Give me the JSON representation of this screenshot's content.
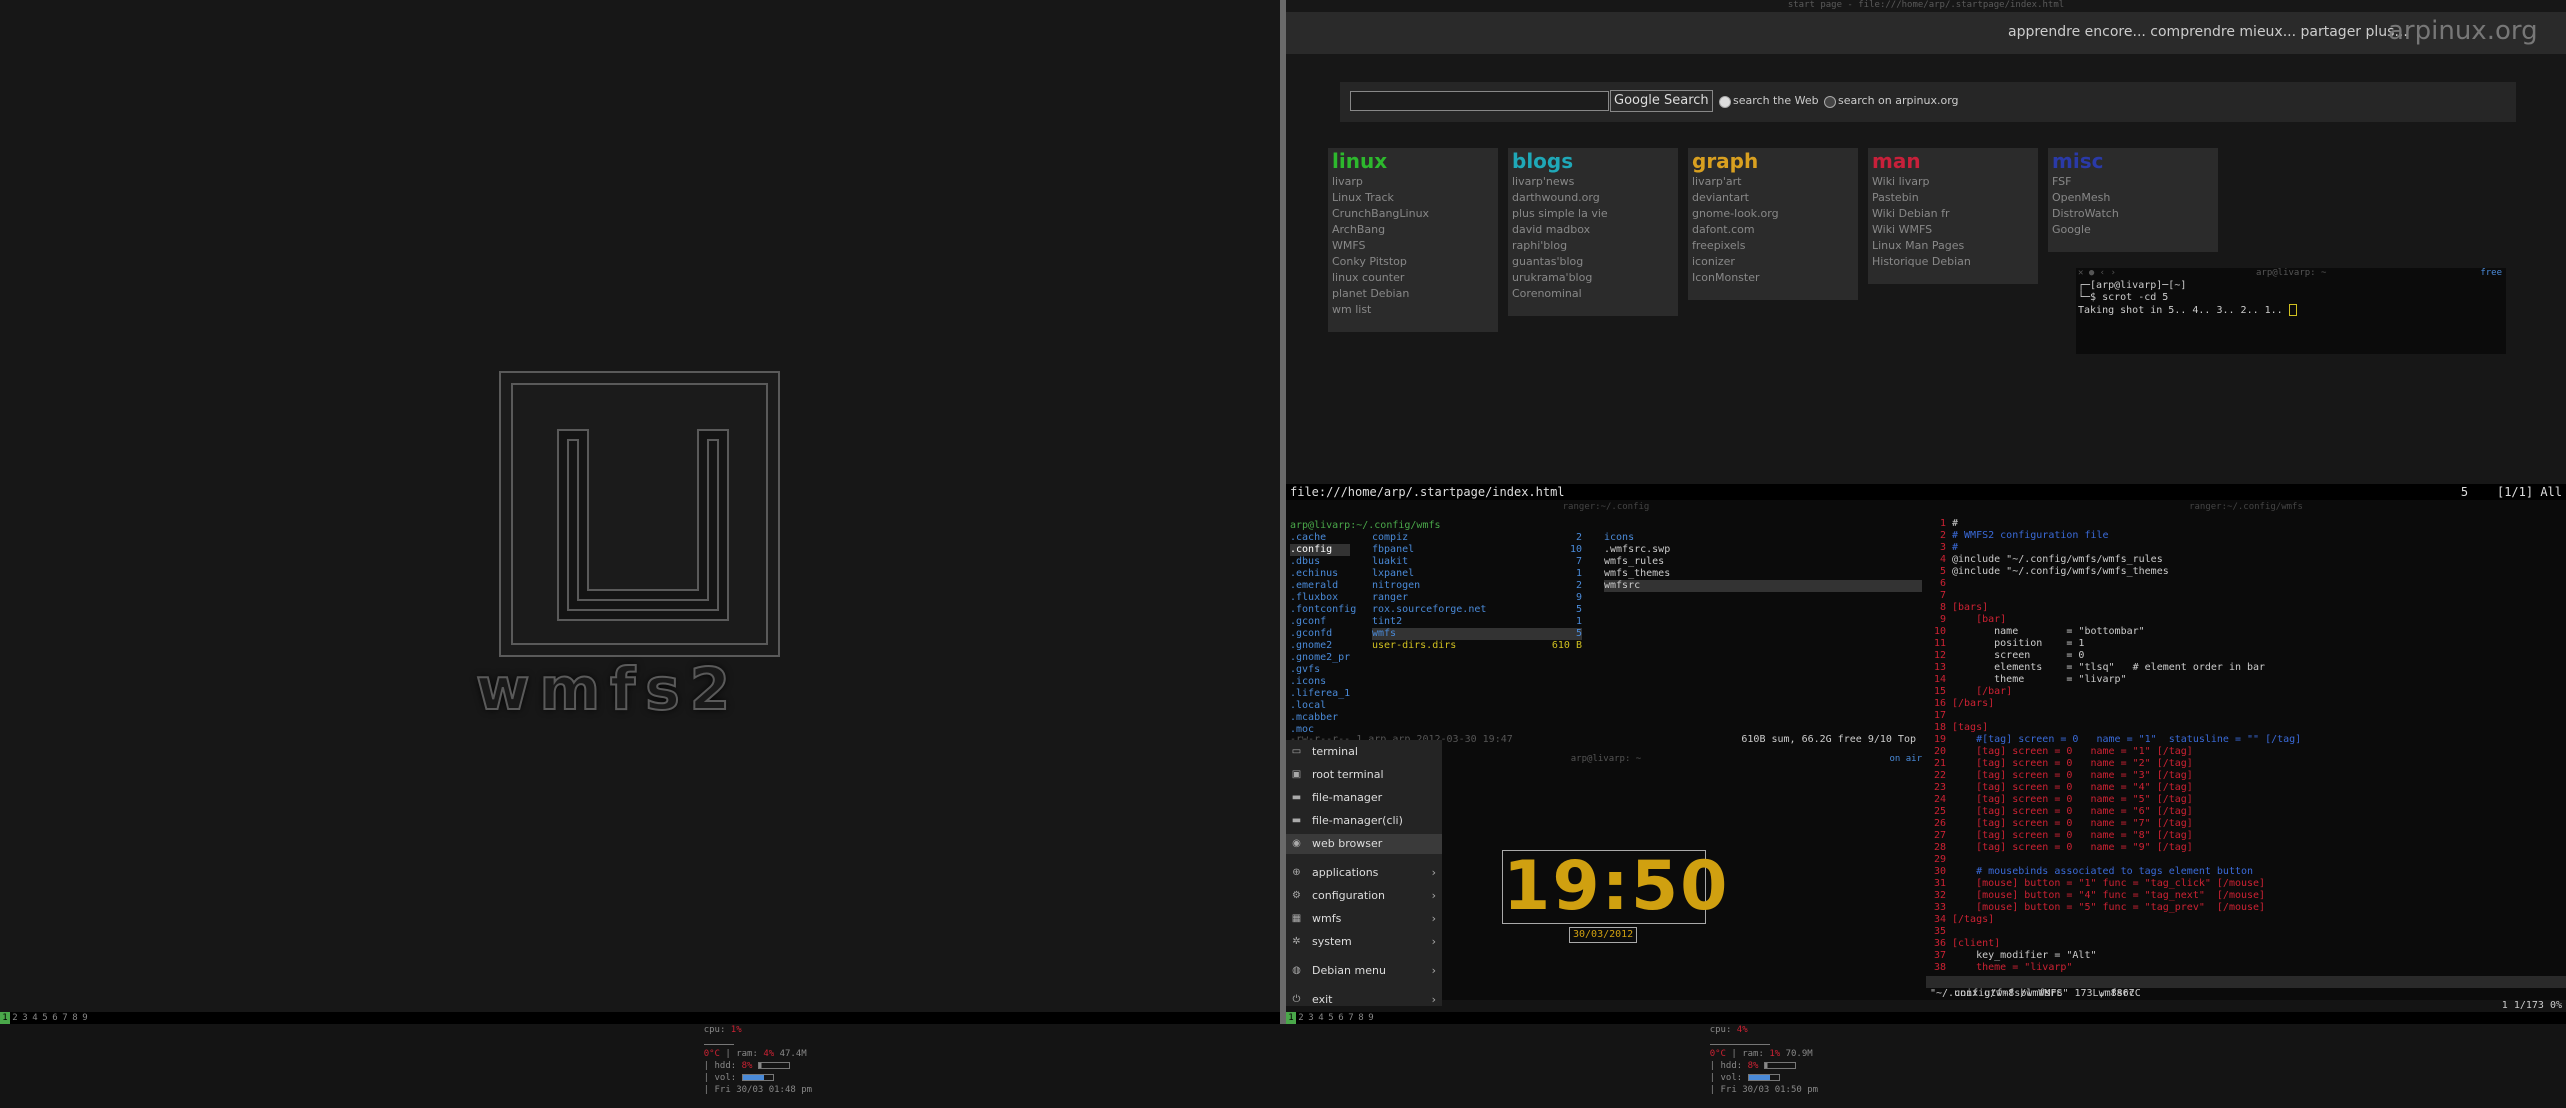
{
  "left_screen": {
    "logo_text": "wmfs2",
    "tags": [
      "1",
      "2",
      "3",
      "4",
      "5",
      "6",
      "7",
      "8",
      "9"
    ],
    "status": {
      "cpu_label": "cpu:",
      "cpu_value": "1%",
      "temp": "0°C",
      "ram_label": "ram:",
      "ram_pct": "4%",
      "ram_value": "47.4M",
      "hdd_label": "hdd:",
      "hdd_value": "8%",
      "vol_label": "vol:",
      "datetime": "Fri 30/03 01:48 pm",
      "cpu_fraction": 0.01,
      "ram_fraction": 0.04,
      "hdd_fraction": 0.08,
      "vol_fraction": 0.7
    }
  },
  "browser": {
    "window_title": "start page - file:///home/arp/.startpage/index.html",
    "tagline": "apprendre encore... comprendre mieux... partager plus...",
    "site_name": "arpinux.org",
    "search_button": "Google Search",
    "radio_web": "search the Web",
    "radio_site": "search on arpinux.org",
    "categories": [
      {
        "title": "linux",
        "color": "#2db82d",
        "links": [
          "livarp",
          "Linux Track",
          "CrunchBangLinux",
          "ArchBang",
          "WMFS",
          "Conky Pitstop",
          "linux counter",
          "planet Debian",
          "wm list"
        ]
      },
      {
        "title": "blogs",
        "color": "#1fa8b8",
        "links": [
          "livarp'news",
          "darthwound.org",
          "plus simple la vie",
          "david madbox",
          "raphi'blog",
          "guantas'blog",
          "urukrama'blog",
          "Corenominal"
        ]
      },
      {
        "title": "graph",
        "color": "#d9a020",
        "links": [
          "livarp'art",
          "deviantart",
          "gnome-look.org",
          "dafont.com",
          "freepixels",
          "iconizer",
          "IconMonster"
        ]
      },
      {
        "title": "man",
        "color": "#c8203a",
        "links": [
          "Wiki livarp",
          "Pastebin",
          "Wiki Debian fr",
          "Wiki WMFS",
          "Linux Man Pages",
          "Historique Debian"
        ]
      },
      {
        "title": "misc",
        "color": "#2a3aa8",
        "links": [
          "FSF",
          "OpenMesh",
          "DistroWatch",
          "Google"
        ]
      }
    ],
    "mini_terminal": {
      "title": "arp@livarp: ~",
      "free": "free",
      "lines": [
        "┌─[arp@livarp]─[~]",
        "└─$ scrot -cd 5",
        "Taking shot in 5.. 4.. 3.. 2.. 1.. "
      ]
    },
    "status_url": "file:///home/arp/.startpage/index.html",
    "status_right": "5    [1/1] All"
  },
  "ranger": {
    "title": "ranger:~/.config",
    "path": "arp@livarp:~/.config/wmfs",
    "col1": [
      ".cache",
      ".config",
      ".dbus",
      ".echinus",
      ".emerald",
      ".fluxbox",
      ".fontconfig",
      ".gconf",
      ".gconfd",
      ".gnome2",
      ".gnome2_pr",
      ".gvfs",
      ".icons",
      ".liferea_1",
      ".local",
      ".mcabber",
      ".moc"
    ],
    "col2": [
      {
        "name": "compiz",
        "n": "2"
      },
      {
        "name": "fbpanel",
        "n": "10"
      },
      {
        "name": "luakit",
        "n": "7"
      },
      {
        "name": "lxpanel",
        "n": "1"
      },
      {
        "name": "nitrogen",
        "n": "2"
      },
      {
        "name": "ranger",
        "n": "9"
      },
      {
        "name": "rox.sourceforge.net",
        "n": "5"
      },
      {
        "name": "tint2",
        "n": "1"
      },
      {
        "name": "wmfs",
        "n": "5"
      },
      {
        "name": "user-dirs.dirs",
        "n": "610 B"
      }
    ],
    "col3": [
      "icons",
      ".wmfsrc.swp",
      "wmfs_rules",
      "wmfs_themes",
      "wmfsrc"
    ],
    "status_left": "-rw-r--r-- 1 arp arp 2012-03-30 19:47",
    "status_right": "610B sum, 66.2G free  9/10  Top"
  },
  "vim": {
    "title": "ranger:~/.config/wmfs",
    "lines": [
      {
        "n": "1",
        "t": "#",
        "c": "#ccc"
      },
      {
        "n": "2",
        "t": "# WMFS2 configuration file",
        "c": "#3a6ad8"
      },
      {
        "n": "3",
        "t": "#",
        "c": "#3a6ad8"
      },
      {
        "n": "4",
        "t": "@include \"~/.config/wmfs/wmfs_rules",
        "c": "#ccc"
      },
      {
        "n": "5",
        "t": "@include \"~/.config/wmfs/wmfs_themes",
        "c": "#ccc"
      },
      {
        "n": "6",
        "t": "",
        "c": "#ccc"
      },
      {
        "n": "7",
        "t": "",
        "c": "#ccc"
      },
      {
        "n": "8",
        "t": "[bars]",
        "c": "#c23"
      },
      {
        "n": "9",
        "t": "    [bar]",
        "c": "#c23"
      },
      {
        "n": "10",
        "t": "       name        = \"bottombar\"",
        "c": "#ccc"
      },
      {
        "n": "11",
        "t": "       position    = 1",
        "c": "#ccc"
      },
      {
        "n": "12",
        "t": "       screen      = 0",
        "c": "#ccc"
      },
      {
        "n": "13",
        "t": "       elements    = \"tlsq\"   # element order in bar",
        "c": "#ccc"
      },
      {
        "n": "14",
        "t": "       theme       = \"livarp\"",
        "c": "#ccc"
      },
      {
        "n": "15",
        "t": "    [/bar]",
        "c": "#c23"
      },
      {
        "n": "16",
        "t": "[/bars]",
        "c": "#c23"
      },
      {
        "n": "17",
        "t": "",
        "c": "#ccc"
      },
      {
        "n": "18",
        "t": "[tags]",
        "c": "#c23"
      },
      {
        "n": "19",
        "t": "    #[tag] screen = 0   name = \"1\"  statusline = \"\" [/tag]",
        "c": "#3a6ad8"
      },
      {
        "n": "20",
        "t": "    [tag] screen = 0   name = \"1\" [/tag]",
        "c": "#c23"
      },
      {
        "n": "21",
        "t": "    [tag] screen = 0   name = \"2\" [/tag]",
        "c": "#c23"
      },
      {
        "n": "22",
        "t": "    [tag] screen = 0   name = \"3\" [/tag]",
        "c": "#c23"
      },
      {
        "n": "23",
        "t": "    [tag] screen = 0   name = \"4\" [/tag]",
        "c": "#c23"
      },
      {
        "n": "24",
        "t": "    [tag] screen = 0   name = \"5\" [/tag]",
        "c": "#c23"
      },
      {
        "n": "25",
        "t": "    [tag] screen = 0   name = \"6\" [/tag]",
        "c": "#c23"
      },
      {
        "n": "26",
        "t": "    [tag] screen = 0   name = \"7\" [/tag]",
        "c": "#c23"
      },
      {
        "n": "27",
        "t": "    [tag] screen = 0   name = \"8\" [/tag]",
        "c": "#c23"
      },
      {
        "n": "28",
        "t": "    [tag] screen = 0   name = \"9\" [/tag]",
        "c": "#c23"
      },
      {
        "n": "29",
        "t": "",
        "c": "#ccc"
      },
      {
        "n": "30",
        "t": "    # mousebinds associated to tags element button",
        "c": "#3a6ad8"
      },
      {
        "n": "31",
        "t": "    [mouse] button = \"1\" func = \"tag_click\" [/mouse]",
        "c": "#c23"
      },
      {
        "n": "32",
        "t": "    [mouse] button = \"4\" func = \"tag_next\"  [/mouse]",
        "c": "#c23"
      },
      {
        "n": "33",
        "t": "    [mouse] button = \"5\" func = \"tag_prev\"  [/mouse]",
        "c": "#c23"
      },
      {
        "n": "34",
        "t": "[/tags]",
        "c": "#c23"
      },
      {
        "n": "35",
        "t": "",
        "c": "#ccc"
      },
      {
        "n": "36",
        "t": "[client]",
        "c": "#c23"
      },
      {
        "n": "37",
        "t": "    key_modifier = \"Alt\"",
        "c": "#ccc"
      },
      {
        "n": "38",
        "t": "    theme = \"livarp\"",
        "c": "#c23"
      }
    ],
    "statusline_left": "unix utf-8 bl WMFS      wmfsrc",
    "statusline_right": "1 1/173 0%",
    "cmdline": "\"~/.config/wmfs/wmfsrc\" 173L, 8867C"
  },
  "clock_terminal": {
    "title": "arp@livarp: ~",
    "right": "on air",
    "time": "19:50",
    "date": "30/03/2012"
  },
  "menu": {
    "items": [
      {
        "label": "terminal",
        "icon": "terminal-icon",
        "glyph": "▭",
        "arrow": false
      },
      {
        "label": "root terminal",
        "icon": "root-terminal-icon",
        "glyph": "▣",
        "arrow": false
      },
      {
        "label": "file-manager",
        "icon": "folder-icon",
        "glyph": "▬",
        "arrow": false
      },
      {
        "label": "file-manager(cli)",
        "icon": "folder-cli-icon",
        "glyph": "▬",
        "arrow": false
      },
      {
        "label": "web browser",
        "icon": "globe-icon",
        "glyph": "◉",
        "arrow": false
      },
      {
        "label": "applications",
        "icon": "applications-icon",
        "glyph": "⊕",
        "arrow": true
      },
      {
        "label": "configuration",
        "icon": "gear-icon",
        "glyph": "⚙",
        "arrow": true
      },
      {
        "label": "wmfs",
        "icon": "wmfs-icon",
        "glyph": "▦",
        "arrow": true
      },
      {
        "label": "system",
        "icon": "system-icon",
        "glyph": "✲",
        "arrow": true
      },
      {
        "label": "Debian menu",
        "icon": "debian-icon",
        "glyph": "◍",
        "arrow": true
      },
      {
        "label": "exit",
        "icon": "exit-icon",
        "glyph": "⏻",
        "arrow": true
      }
    ]
  },
  "right_bar": {
    "tags": [
      "1",
      "2",
      "3",
      "4",
      "5",
      "6",
      "7",
      "8",
      "9"
    ],
    "cpu_label": "cpu:",
    "cpu_value": "4%",
    "temp": "0°C",
    "ram_label": "ram:",
    "ram_pct": "1%",
    "ram_value": "70.9M",
    "hdd_label": "hdd:",
    "hdd_value": "8%",
    "vol_label": "vol:",
    "datetime": "Fri 30/03 01:50 pm",
    "cpu_fraction": 0.04,
    "ram_fraction": 0.01,
    "hdd_fraction": 0.08,
    "vol_fraction": 0.7
  }
}
